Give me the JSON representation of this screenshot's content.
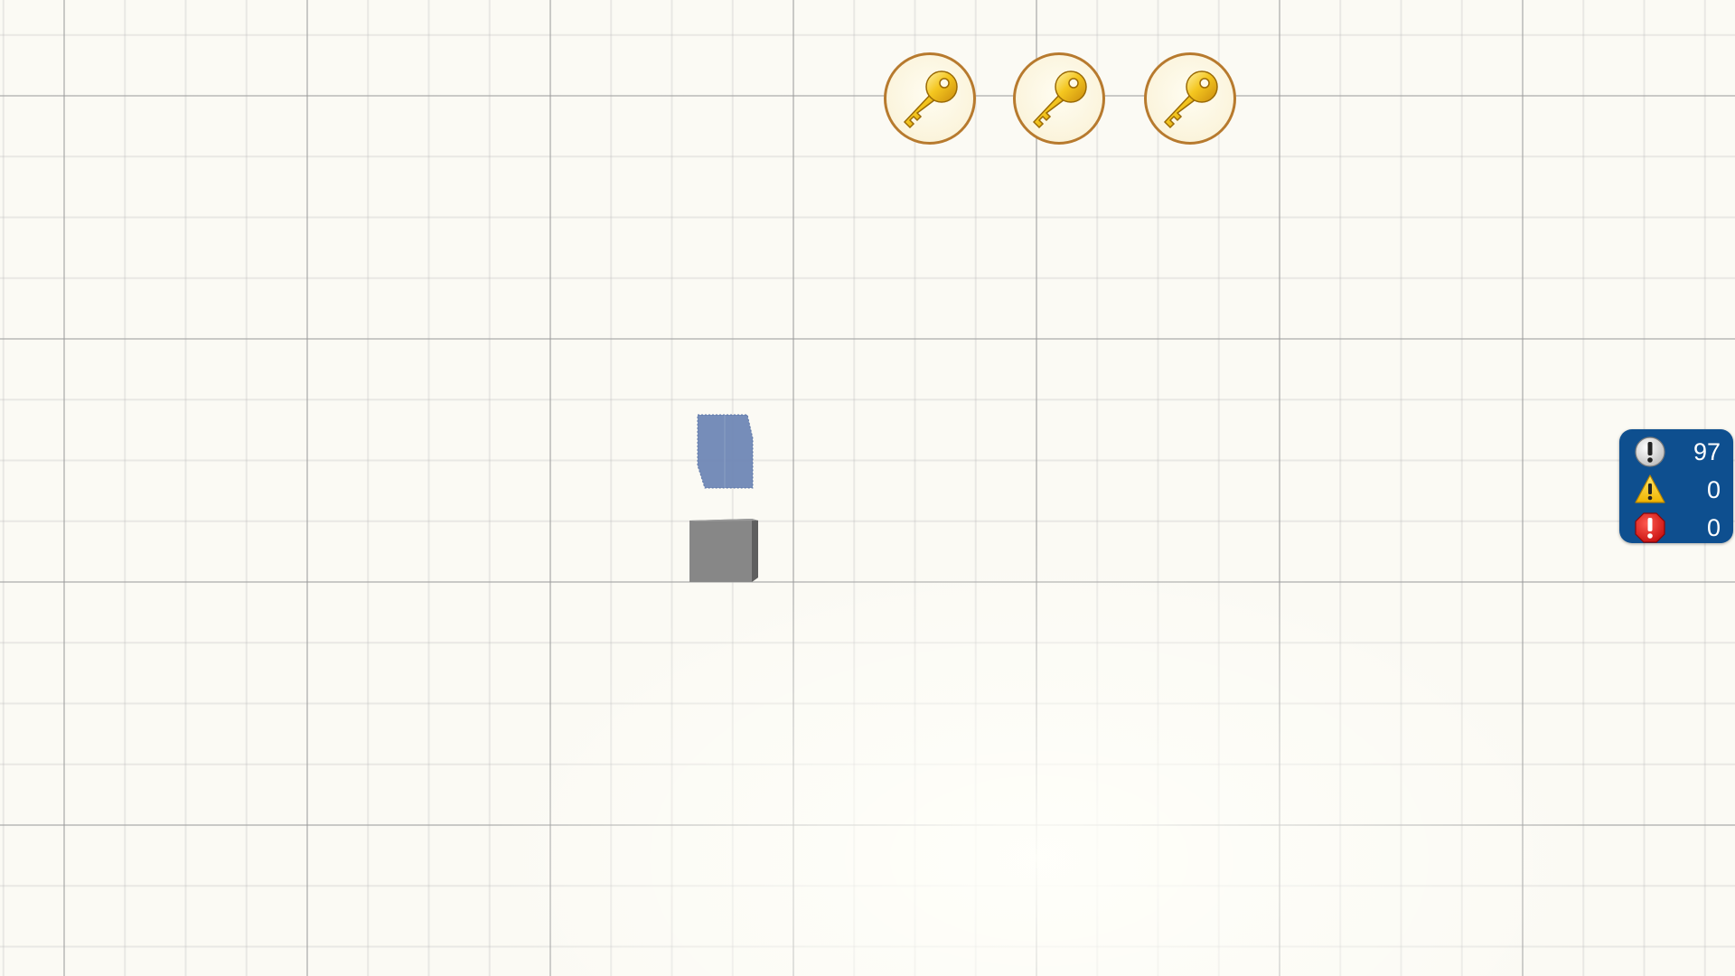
{
  "hud": {
    "keys": [
      {
        "icon": "gold-key-icon"
      },
      {
        "icon": "gold-key-icon"
      },
      {
        "icon": "gold-key-icon"
      }
    ]
  },
  "scene": {
    "blocks": [
      {
        "name": "blue-block",
        "color": "#6f87b5"
      },
      {
        "name": "gray-block",
        "color": "#878787"
      }
    ]
  },
  "status_panel": {
    "info": {
      "icon": "info-icon",
      "count": "97"
    },
    "warning": {
      "icon": "warning-icon",
      "count": "0"
    },
    "error": {
      "icon": "error-icon",
      "count": "0"
    }
  },
  "colors": {
    "background": "#fbfaf4",
    "grid_line": "#c8c8c8",
    "panel_bg": "#0e4f8f",
    "token_border": "#b77a2e",
    "key_gold": "#f2c21e"
  }
}
